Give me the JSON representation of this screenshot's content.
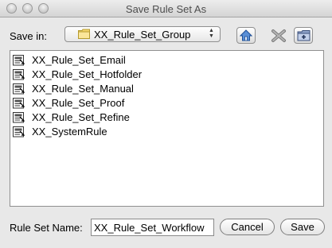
{
  "window": {
    "title": "Save Rule Set As"
  },
  "location": {
    "label": "Save in:",
    "selected_folder": "XX_Rule_Set_Group"
  },
  "toolbar": {
    "home_icon": "home-icon",
    "delete_icon": "delete-icon",
    "new_folder_icon": "new-folder-icon"
  },
  "files": [
    {
      "name": "XX_Rule_Set_Email"
    },
    {
      "name": "XX_Rule_Set_Hotfolder"
    },
    {
      "name": "XX_Rule_Set_Manual"
    },
    {
      "name": "XX_Rule_Set_Proof"
    },
    {
      "name": "XX_Rule_Set_Refine"
    },
    {
      "name": "XX_SystemRule"
    }
  ],
  "footer": {
    "name_label": "Rule Set Name:",
    "name_value": "XX_Rule_Set_Workflow",
    "cancel_label": "Cancel",
    "save_label": "Save"
  },
  "colors": {
    "window_bg": "#e8e8e8",
    "list_bg": "#ffffff",
    "folder_yellow": "#f5d76e"
  }
}
